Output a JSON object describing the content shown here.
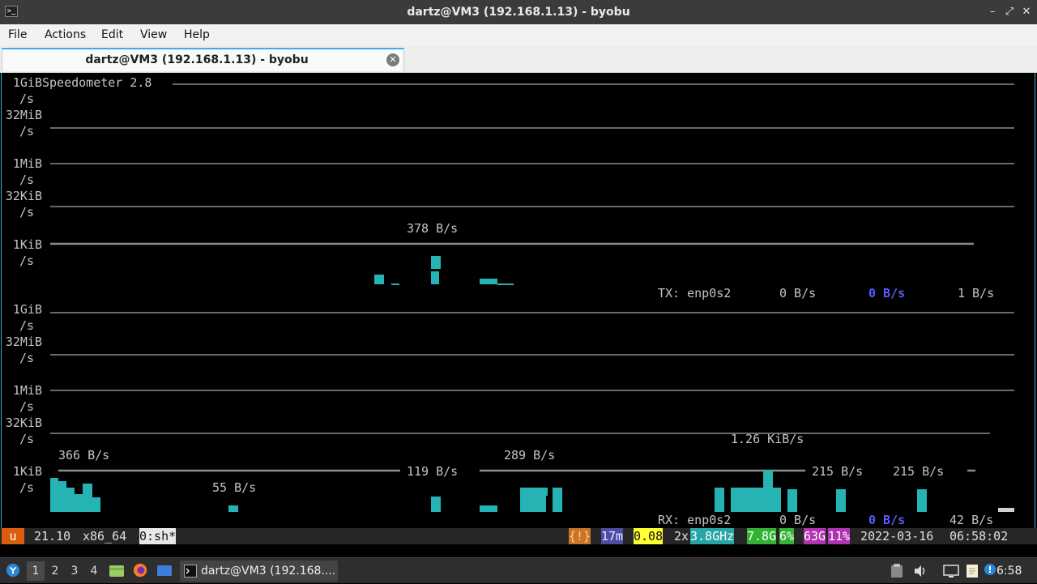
{
  "window": {
    "title": "dartz@VM3 (192.168.1.13) - byobu"
  },
  "menu": [
    "File",
    "Actions",
    "Edit",
    "View",
    "Help"
  ],
  "tab": {
    "title": "dartz@VM3 (192.168.1.13) - byobu"
  },
  "terminal": {
    "program_title": "Speedometer 2.8",
    "axis_labels": [
      "1GiB",
      "/s",
      "32MiB",
      "/s",
      "1MiB",
      "/s",
      "32KiB",
      "/s",
      "1KiB",
      "/s"
    ],
    "tx": {
      "peak_label": "378 B/s",
      "iface_label": "TX: enp0s2",
      "current": "0 B/s",
      "average": "0 B/s",
      "max": "1 B/s"
    },
    "rx": {
      "value_labels": [
        "366 B/s",
        "55 B/s",
        "119 B/s",
        "289 B/s",
        "1.26 KiB/s",
        "215 B/s",
        "215 B/s"
      ],
      "iface_label": "RX: enp0s2",
      "current": "0 B/s",
      "average": "0 B/s",
      "max": "42 B/s"
    }
  },
  "status_bar": {
    "logo": "u",
    "release": "21.10",
    "arch": "x86_64",
    "window": "0:sh*",
    "alert": "{!}",
    "uptime": "17m",
    "load": "0.08",
    "cpu_count": "2x",
    "cpu_freq": "3.8GHz",
    "mem_total": "7.8G",
    "mem_pct": "6%",
    "disk_total": "63G",
    "disk_pct": "11%",
    "date": "2022-03-16",
    "time": "06:58:02",
    "colors": {
      "logo_bg": "#dd5d0e",
      "alert_bg": "#c8742a",
      "uptime_bg": "#4d4da6",
      "load_bg": "#ffff33",
      "cpu_bg": "#2aa5a5",
      "mem_bg": "#33b233",
      "disk_bg": "#b233b2",
      "bar_accent": "#25b3b3"
    }
  },
  "taskbar": {
    "workspaces": [
      "1",
      "2",
      "3",
      "4"
    ],
    "active_workspace": "1",
    "task_label": "dartz@VM3 (192.168....",
    "clock": "6:58",
    "icons": [
      "start-menu-icon",
      "files-icon",
      "firefox-icon",
      "desktop-icon",
      "terminal-icon",
      "clipboard-icon",
      "volume-icon",
      "display-icon",
      "notes-icon",
      "updates-icon"
    ]
  }
}
